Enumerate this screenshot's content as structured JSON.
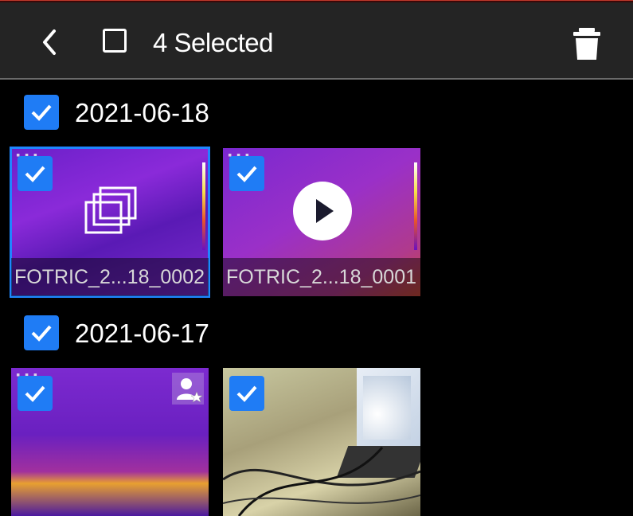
{
  "topbar": {
    "selected_label": "4 Selected"
  },
  "groups": [
    {
      "date": "2021-06-18",
      "items": [
        {
          "name": "FOTRIC_2...18_0002",
          "kind": "burst",
          "selected": true
        },
        {
          "name": "FOTRIC_2...18_0001",
          "kind": "video",
          "selected": true
        }
      ]
    },
    {
      "date": "2021-06-17",
      "items": [
        {
          "kind": "thermal-image",
          "selected": true
        },
        {
          "kind": "photo",
          "selected": true
        }
      ]
    }
  ],
  "colors": {
    "accent": "#1f7cf5",
    "topbar": "#242424",
    "background": "#000000"
  }
}
